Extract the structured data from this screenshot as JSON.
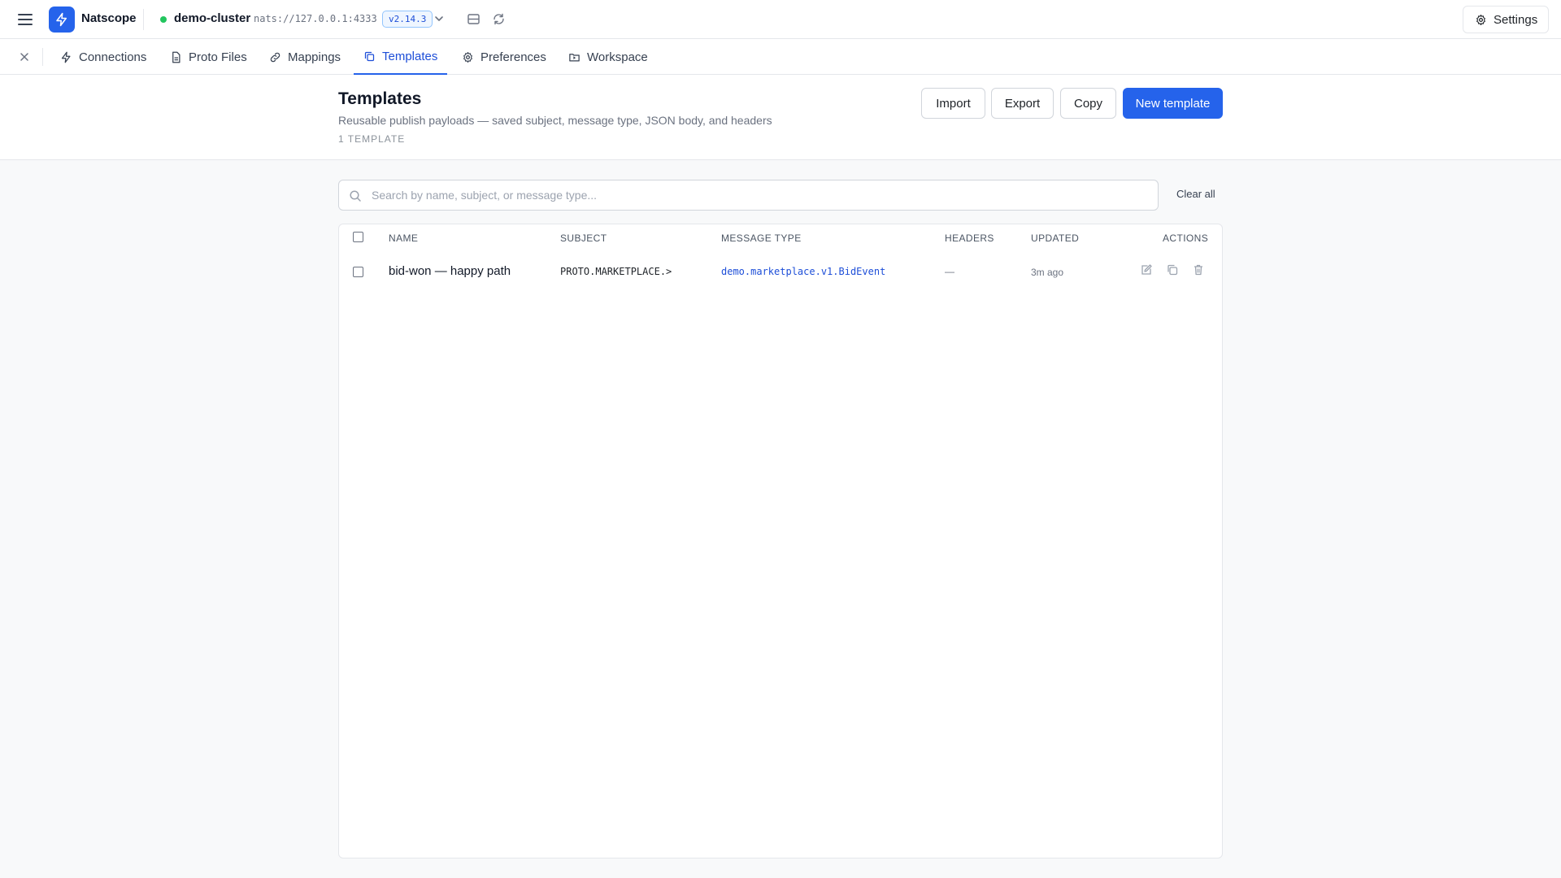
{
  "topbar": {
    "app_name": "Natscope",
    "cluster_name": "demo-cluster",
    "cluster_url": "nats://127.0.0.1:4333",
    "version": "v2.14.3",
    "status_color": "#22c55e",
    "settings_label": "Settings"
  },
  "tabs": [
    {
      "label": "Connections",
      "icon": "bolt-icon",
      "active": false
    },
    {
      "label": "Proto Files",
      "icon": "file-icon",
      "active": false
    },
    {
      "label": "Mappings",
      "icon": "link-icon",
      "active": false
    },
    {
      "label": "Templates",
      "icon": "copy-icon",
      "active": true
    },
    {
      "label": "Preferences",
      "icon": "gear-icon",
      "active": false
    },
    {
      "label": "Workspace",
      "icon": "folder-icon",
      "active": false
    }
  ],
  "header": {
    "title": "Templates",
    "subtitle": "Reusable publish payloads — saved subject, message type, JSON body, and headers",
    "count": "1 TEMPLATE",
    "buttons": {
      "import": "Import",
      "export": "Export",
      "copy": "Copy",
      "new_template": "New template"
    }
  },
  "search": {
    "placeholder": "Search by name, subject, or message type...",
    "value": "",
    "clear_label": "Clear all"
  },
  "table": {
    "columns": [
      "NAME",
      "SUBJECT",
      "MESSAGE TYPE",
      "HEADERS",
      "UPDATED",
      "ACTIONS"
    ],
    "rows": [
      {
        "name": "bid-won — happy path",
        "subject": "PROTO.MARKETPLACE.>",
        "message_type": "demo.marketplace.v1.BidEvent",
        "headers": "—",
        "updated": "3m ago"
      }
    ]
  },
  "colors": {
    "accent": "#2563eb",
    "link": "#1d4ed8"
  }
}
